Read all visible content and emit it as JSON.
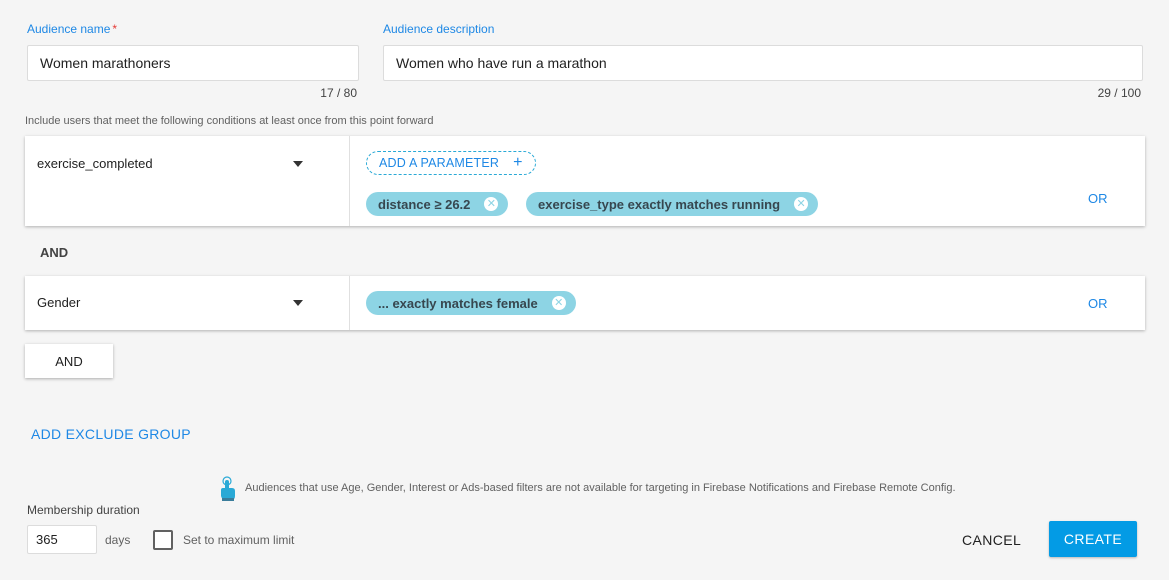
{
  "audience_name": {
    "label": "Audience name",
    "required_mark": "*",
    "value": "Women marathoners",
    "counter": "17 / 80"
  },
  "audience_description": {
    "label": "Audience description",
    "value": "Women who have run a marathon",
    "counter": "29 / 100"
  },
  "conditions_hint": "Include users that meet the following conditions at least once from this point forward",
  "conditions": [
    {
      "event": "exercise_completed",
      "add_parameter_label": "ADD A PARAMETER",
      "add_parameter_plus": "+",
      "chips": [
        "distance ≥ 26.2",
        "exercise_type exactly matches running"
      ],
      "or_label": "OR"
    },
    {
      "event": "Gender",
      "chips": [
        "... exactly matches female"
      ],
      "or_label": "OR"
    }
  ],
  "and_separator": "AND",
  "and_button": "AND",
  "add_exclude_group": "ADD EXCLUDE GROUP",
  "notice": {
    "icon": "touch-hand-icon",
    "text": "Audiences that use Age, Gender, Interest or Ads-based filters are not available for targeting in Firebase Notifications and Firebase Remote Config."
  },
  "membership": {
    "label": "Membership duration",
    "value": "365",
    "unit": "days",
    "max_limit_label": "Set to maximum limit",
    "max_limit_checked": false
  },
  "actions": {
    "cancel": "CANCEL",
    "create": "CREATE"
  },
  "colors": {
    "accent": "#1e88e5",
    "chip": "#8dd4e4",
    "primary_button": "#039be5"
  }
}
